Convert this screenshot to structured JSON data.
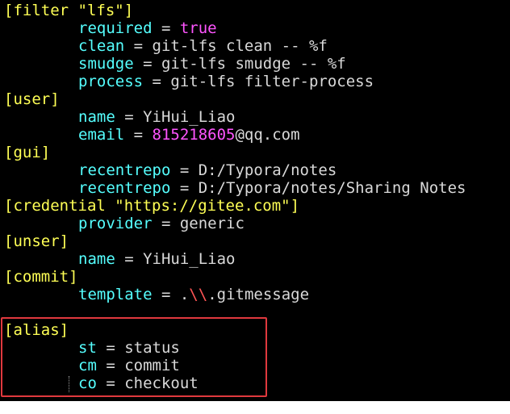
{
  "terminal": {
    "lines": [
      {
        "type": "section",
        "text": "[filter \"lfs\"]"
      },
      {
        "type": "kv",
        "key": "required",
        "op": " = ",
        "value": "true",
        "valueStyle": "bool"
      },
      {
        "type": "kv",
        "key": "clean",
        "op": " = ",
        "value": "git-lfs clean -- %f"
      },
      {
        "type": "kv",
        "key": "smudge",
        "op": " = ",
        "value": "git-lfs smudge -- %f"
      },
      {
        "type": "kv",
        "key": "process",
        "op": " = ",
        "value": "git-lfs filter-process"
      },
      {
        "type": "section",
        "text": "[user]"
      },
      {
        "type": "kv",
        "key": "name",
        "op": " = ",
        "value": "YiHui_Liao"
      },
      {
        "type": "kv",
        "key": "email",
        "op": " = ",
        "valueParts": [
          {
            "text": "815218605",
            "style": "num"
          },
          {
            "text": "@qq.com",
            "style": "val"
          }
        ]
      },
      {
        "type": "section",
        "text": "[gui]"
      },
      {
        "type": "kv",
        "key": "recentrepo",
        "op": " = ",
        "value": "D:/Typora/notes"
      },
      {
        "type": "kv",
        "key": "recentrepo",
        "op": " = ",
        "value": "D:/Typora/notes/Sharing Notes"
      },
      {
        "type": "section",
        "text": "[credential \"https://gitee.com\"]"
      },
      {
        "type": "kv",
        "key": "provider",
        "op": " = ",
        "value": "generic"
      },
      {
        "type": "section",
        "text": "[unser]"
      },
      {
        "type": "kv",
        "key": "name",
        "op": " = ",
        "value": "YiHui_Liao"
      },
      {
        "type": "section",
        "text": "[commit]"
      },
      {
        "type": "kv",
        "key": "template",
        "op": " = ",
        "valueParts": [
          {
            "text": ".",
            "style": "val"
          },
          {
            "text": "\\\\",
            "style": "esc"
          },
          {
            "text": ".gitmessage",
            "style": "val"
          }
        ]
      },
      {
        "type": "blank"
      },
      {
        "type": "section",
        "text": "[alias]"
      },
      {
        "type": "kv",
        "key": "st",
        "op": " = ",
        "value": "status"
      },
      {
        "type": "kv",
        "key": "cm",
        "op": " = ",
        "value": "commit"
      },
      {
        "type": "kv",
        "key": "co",
        "op": " = ",
        "value": "checkout"
      }
    ]
  },
  "colors": {
    "section": "#ffff55",
    "key": "#55ffff",
    "value": "#d9d9d9",
    "number": "#ff55ff",
    "escape": "#ff5555",
    "highlight": "#e0393e",
    "background": "#000000"
  }
}
